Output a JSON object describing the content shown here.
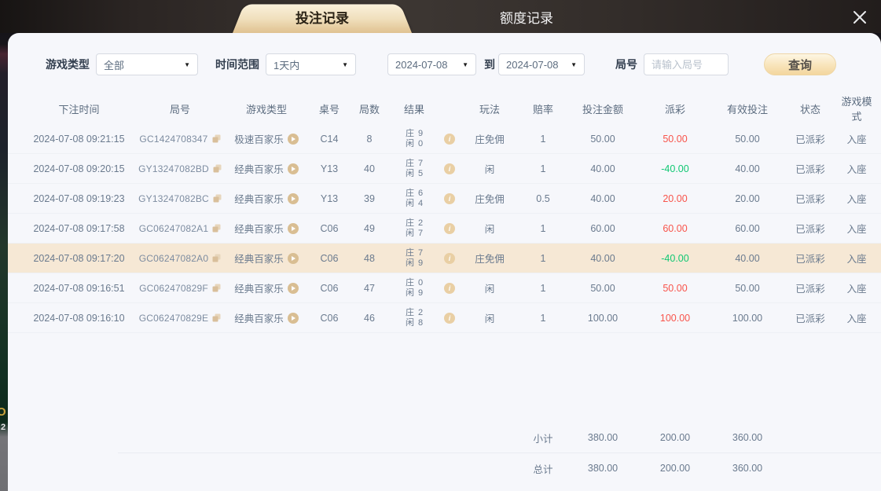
{
  "tabs": [
    {
      "label": "投注记录",
      "active": true
    },
    {
      "label": "额度记录",
      "active": false
    }
  ],
  "background": {
    "edge_glyphs": [
      "O",
      "2"
    ]
  },
  "filters": {
    "game_type_label": "游戏类型",
    "game_type_value": "全部",
    "time_range_label": "时间范围",
    "time_range_value": "1天内",
    "date_from": "2024-07-08",
    "to_label": "到",
    "date_to": "2024-07-08",
    "round_label": "局号",
    "round_placeholder": "请输入局号",
    "search_button": "查询"
  },
  "table": {
    "headers": [
      "下注时间",
      "局号",
      "游戏类型",
      "桌号",
      "局数",
      "结果",
      "玩法",
      "赔率",
      "投注金额",
      "派彩",
      "有效投注",
      "状态",
      "游戏模式"
    ],
    "result_labels": {
      "banker": "庄",
      "player": "闲"
    },
    "rows": [
      {
        "time": "2024-07-08 09:21:15",
        "round_id": "GC1424708347",
        "game": "极速百家乐",
        "table_no": "C14",
        "round_no": "8",
        "banker": "9",
        "player": "0",
        "play": "庄免佣",
        "odds": "1",
        "bet": "50.00",
        "payout": "50.00",
        "payout_type": "win",
        "valid_bet": "50.00",
        "status": "已派彩",
        "mode": "入座",
        "highlight": false
      },
      {
        "time": "2024-07-08 09:20:15",
        "round_id": "GY13247082BD",
        "game": "经典百家乐",
        "table_no": "Y13",
        "round_no": "40",
        "banker": "7",
        "player": "5",
        "play": "闲",
        "odds": "1",
        "bet": "40.00",
        "payout": "-40.00",
        "payout_type": "loss",
        "valid_bet": "40.00",
        "status": "已派彩",
        "mode": "入座",
        "highlight": false
      },
      {
        "time": "2024-07-08 09:19:23",
        "round_id": "GY13247082BC",
        "game": "经典百家乐",
        "table_no": "Y13",
        "round_no": "39",
        "banker": "6",
        "player": "4",
        "play": "庄免佣",
        "odds": "0.5",
        "bet": "40.00",
        "payout": "20.00",
        "payout_type": "win",
        "valid_bet": "20.00",
        "status": "已派彩",
        "mode": "入座",
        "highlight": false
      },
      {
        "time": "2024-07-08 09:17:58",
        "round_id": "GC06247082A1",
        "game": "经典百家乐",
        "table_no": "C06",
        "round_no": "49",
        "banker": "2",
        "player": "7",
        "play": "闲",
        "odds": "1",
        "bet": "60.00",
        "payout": "60.00",
        "payout_type": "win",
        "valid_bet": "60.00",
        "status": "已派彩",
        "mode": "入座",
        "highlight": false
      },
      {
        "time": "2024-07-08 09:17:20",
        "round_id": "GC06247082A0",
        "game": "经典百家乐",
        "table_no": "C06",
        "round_no": "48",
        "banker": "7",
        "player": "9",
        "play": "庄免佣",
        "odds": "1",
        "bet": "40.00",
        "payout": "-40.00",
        "payout_type": "loss",
        "valid_bet": "40.00",
        "status": "已派彩",
        "mode": "入座",
        "highlight": true
      },
      {
        "time": "2024-07-08 09:16:51",
        "round_id": "GC062470829F",
        "game": "经典百家乐",
        "table_no": "C06",
        "round_no": "47",
        "banker": "0",
        "player": "9",
        "play": "闲",
        "odds": "1",
        "bet": "50.00",
        "payout": "50.00",
        "payout_type": "win",
        "valid_bet": "50.00",
        "status": "已派彩",
        "mode": "入座",
        "highlight": false
      },
      {
        "time": "2024-07-08 09:16:10",
        "round_id": "GC062470829E",
        "game": "经典百家乐",
        "table_no": "C06",
        "round_no": "46",
        "banker": "2",
        "player": "8",
        "play": "闲",
        "odds": "1",
        "bet": "100.00",
        "payout": "100.00",
        "payout_type": "win",
        "valid_bet": "100.00",
        "status": "已派彩",
        "mode": "入座",
        "highlight": false
      }
    ],
    "subtotal": {
      "label": "小计",
      "bet": "380.00",
      "payout": "200.00",
      "valid_bet": "360.00"
    },
    "total": {
      "label": "总计",
      "bet": "380.00",
      "payout": "200.00",
      "valid_bet": "360.00"
    }
  },
  "colors": {
    "win": "#f8544b",
    "loss": "#10c873",
    "accent_gold": "#d9be93",
    "row_highlight": "#f6e8d5"
  }
}
